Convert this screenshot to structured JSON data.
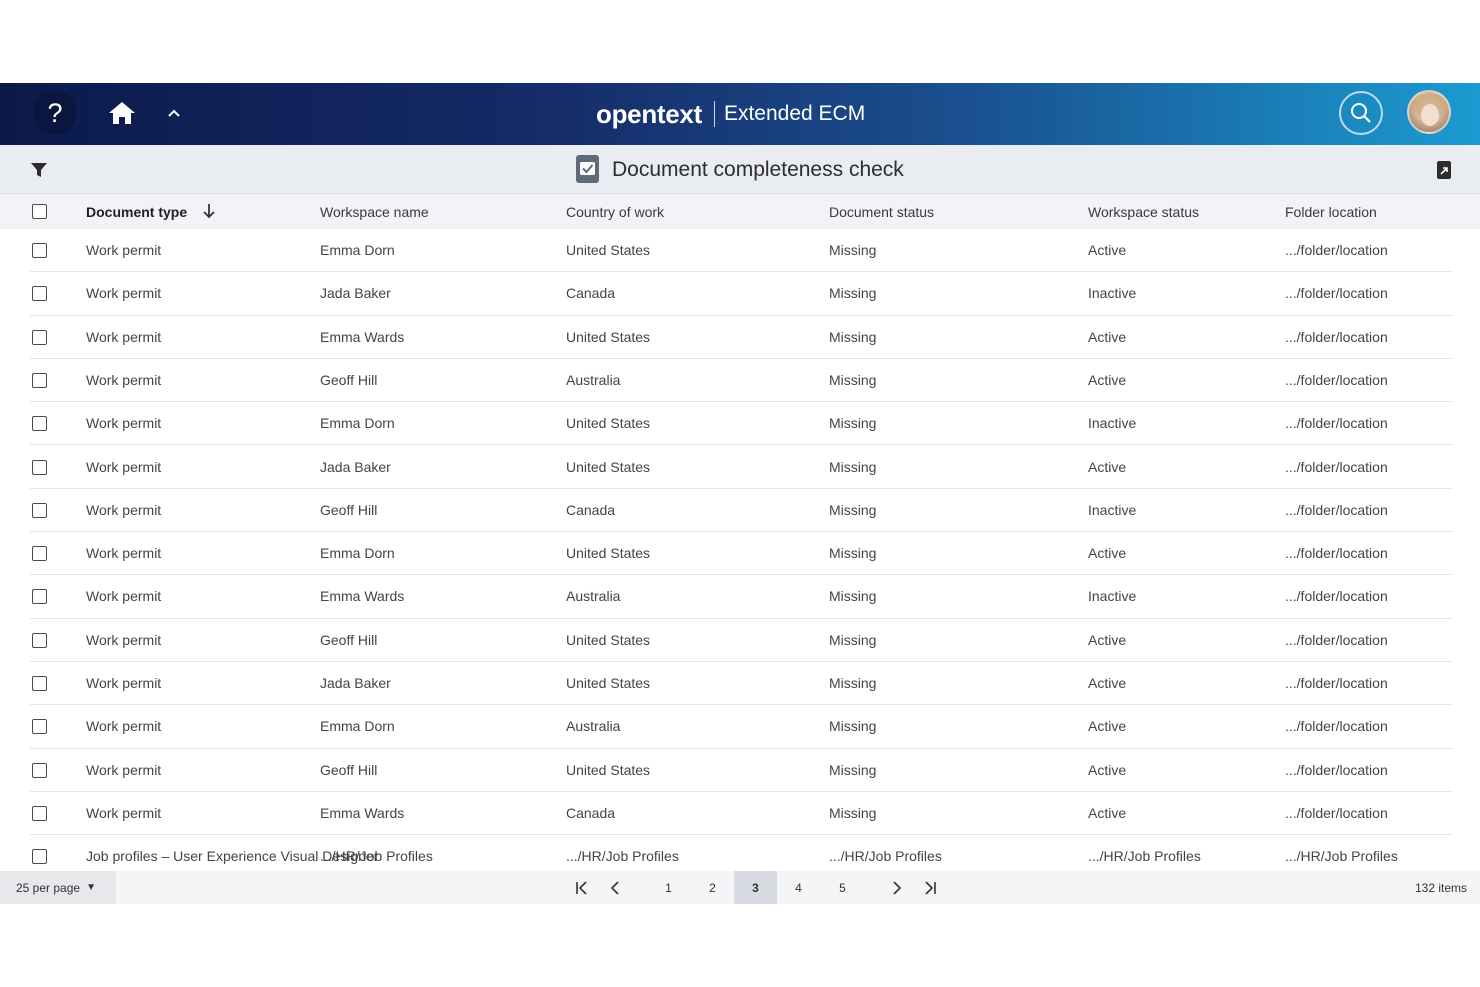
{
  "header": {
    "brand_logo": "opentext",
    "brand_product": "Extended ECM",
    "help_label": "?"
  },
  "titlebar": {
    "title": "Document completeness check"
  },
  "table": {
    "columns": [
      "Document type",
      "Workspace name",
      "Country of work",
      "Document status",
      "Workspace status",
      "Folder location"
    ],
    "rows": [
      [
        "Work permit",
        "Emma Dorn",
        "United States",
        "Missing",
        "Active",
        ".../folder/location"
      ],
      [
        "Work permit",
        "Jada Baker",
        "Canada",
        "Missing",
        "Inactive",
        ".../folder/location"
      ],
      [
        "Work permit",
        "Emma Wards",
        "United States",
        "Missing",
        "Active",
        ".../folder/location"
      ],
      [
        "Work permit",
        "Geoff Hill",
        "Australia",
        "Missing",
        "Active",
        ".../folder/location"
      ],
      [
        "Work permit",
        "Emma Dorn",
        "United States",
        "Missing",
        "Inactive",
        ".../folder/location"
      ],
      [
        "Work permit",
        "Jada Baker",
        "United States",
        "Missing",
        "Active",
        ".../folder/location"
      ],
      [
        "Work permit",
        "Geoff Hill",
        "Canada",
        "Missing",
        "Inactive",
        ".../folder/location"
      ],
      [
        "Work permit",
        "Emma Dorn",
        "United States",
        "Missing",
        "Active",
        ".../folder/location"
      ],
      [
        "Work permit",
        "Emma Wards",
        "Australia",
        "Missing",
        "Inactive",
        ".../folder/location"
      ],
      [
        "Work permit",
        "Geoff Hill",
        "United States",
        "Missing",
        "Active",
        ".../folder/location"
      ],
      [
        "Work permit",
        "Jada Baker",
        "United States",
        "Missing",
        "Active",
        ".../folder/location"
      ],
      [
        "Work permit",
        "Emma Dorn",
        "Australia",
        "Missing",
        "Active",
        ".../folder/location"
      ],
      [
        "Work permit",
        "Geoff Hill",
        "United States",
        "Missing",
        "Active",
        ".../folder/location"
      ],
      [
        "Work permit",
        "Emma Wards",
        "Canada",
        "Missing",
        "Active",
        ".../folder/location"
      ],
      [
        "Job profiles – User Experience Visual Designer",
        ".../HR/Job Profiles",
        ".../HR/Job Profiles",
        ".../HR/Job Profiles",
        ".../HR/Job Profiles",
        ".../HR/Job Profiles"
      ]
    ]
  },
  "footer": {
    "per_page": "25 per page",
    "pages": [
      "1",
      "2",
      "3",
      "4",
      "5"
    ],
    "active_page": "3",
    "items_count": "132 items"
  },
  "colors": {
    "header_start": "#0b1a4a",
    "header_end": "#1b9bd1",
    "titlebar_bg": "#e9ecf0"
  }
}
